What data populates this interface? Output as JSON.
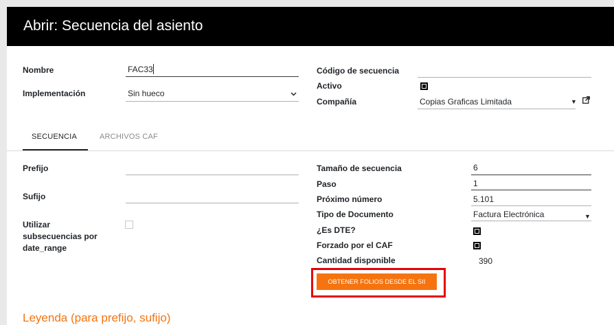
{
  "window": {
    "title": "Abrir: Secuencia del asiento"
  },
  "form_left": {
    "nombre_label": "Nombre",
    "nombre_value": "FAC33",
    "implementacion_label": "Implementación",
    "implementacion_value": "Sin hueco"
  },
  "form_right": {
    "codigo_label": "Código de secuencia",
    "codigo_value": "",
    "activo_label": "Activo",
    "activo_checked": true,
    "compania_label": "Compañía",
    "compania_value": "Copias Graficas Limitada"
  },
  "tabs": [
    {
      "label": "SECUENCIA",
      "active": true
    },
    {
      "label": "ARCHIVOS CAF",
      "active": false
    }
  ],
  "secuencia_left": {
    "prefijo_label": "Prefijo",
    "prefijo_value": "",
    "sufijo_label": "Sufijo",
    "sufijo_value": "",
    "utilizar_label_1": "Utilizar",
    "utilizar_label_2": "subsecuencias por",
    "utilizar_label_3": "date_range",
    "utilizar_checked": false
  },
  "secuencia_right": {
    "tamano_label": "Tamaño de secuencia",
    "tamano_value": "6",
    "paso_label": "Paso",
    "paso_value": "1",
    "proximo_label": "Próximo número",
    "proximo_value": "5.101",
    "tipo_doc_label": "Tipo de Documento",
    "tipo_doc_value": "Factura Electrónica",
    "es_dte_label": "¿Es DTE?",
    "es_dte_checked": true,
    "forzado_label": "Forzado por el CAF",
    "forzado_checked": true,
    "cantidad_label": "Cantidad disponible",
    "cantidad_value": "390"
  },
  "actions": {
    "obtener_folios_label": "OBTENER FOLIOS DESDE EL SII"
  },
  "legend": {
    "title": "Leyenda (para prefijo, sufijo)"
  },
  "colors": {
    "accent": "#f5740f",
    "highlight_box": "#e60000",
    "titlebar": "#000000"
  },
  "icons": {
    "external_link": "external-link-icon",
    "dropdown": "caret-down-icon"
  }
}
